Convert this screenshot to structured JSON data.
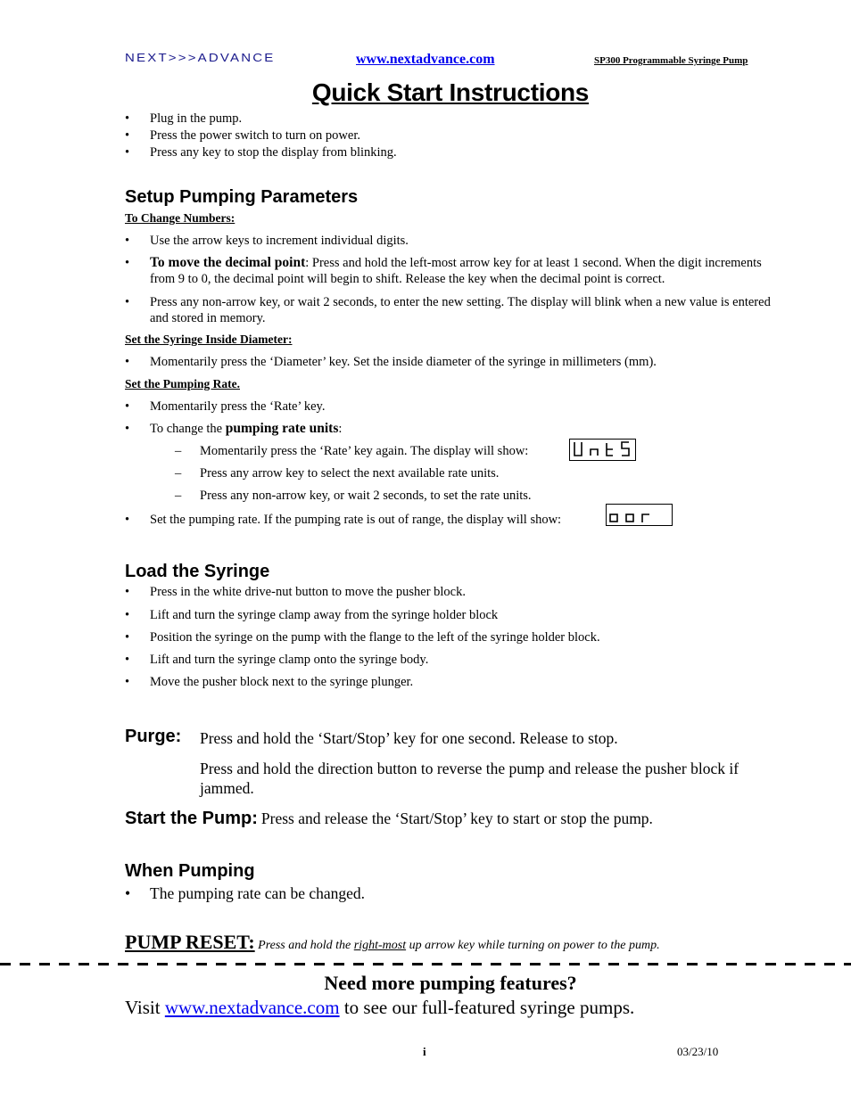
{
  "header": {
    "logo": "NEXT>>>ADVANCE",
    "website": "www.nextadvance.com",
    "product": "SP300 Programmable Syringe Pump"
  },
  "title": "Quick Start Instructions",
  "intro_bullets": [
    "Plug in the pump.",
    "Press the power switch to turn on power.",
    "Press any key to stop the display from blinking."
  ],
  "setup": {
    "heading": "Setup Pumping Parameters",
    "change_numbers": {
      "heading": "To Change Numbers:",
      "bullet1": "Use the arrow keys to increment individual digits.",
      "bullet2_bold": "To move the decimal point",
      "bullet2_text": ":  Press and hold the left-most arrow key for at least 1 second.  When the digit increments from 9 to 0, the decimal point will begin to shift.  Release the key when the decimal point is correct.",
      "bullet3": "Press any non-arrow key, or wait 2 seconds, to enter the new setting.  The display will blink when a new value is entered and stored in memory."
    },
    "diameter": {
      "heading": "Set the Syringe Inside Diameter:",
      "bullet1": "Momentarily press the ‘Diameter’ key.  Set the inside diameter of the syringe in millimeters (mm)."
    },
    "rate": {
      "heading": "Set the Pumping Rate.",
      "bullet1": "Momentarily press the ‘Rate’ key.",
      "bullet2_prefix": "To change the ",
      "bullet2_bold": "pumping rate units",
      "bullet2_suffix": ":",
      "sub1": "Momentarily press the ‘Rate’ key again.  The display will show:",
      "sub1_display": "UntS",
      "sub2": "Press any arrow key to select the next available rate units.",
      "sub3": "Press any non-arrow key, or wait 2 seconds, to set the rate units.",
      "bullet3": "Set the pumping rate.  If the pumping rate is out of range, the display will show:",
      "bullet3_display": "oor"
    }
  },
  "load": {
    "heading": "Load the Syringe",
    "bullets": [
      "Press in the white drive-nut button to move the pusher block.",
      "Lift and turn the syringe clamp away from the syringe holder block",
      "Position the syringe on the pump with the flange to the left of the syringe holder block.",
      "Lift and turn the syringe clamp onto the syringe body.",
      "Move the pusher block next to the syringe plunger."
    ]
  },
  "purge": {
    "label": "Purge:",
    "text1": "Press and hold the ‘Start/Stop’ key for one second.  Release to stop.",
    "text2": "Press and hold the direction button to reverse the pump and release the pusher block if jammed."
  },
  "start": {
    "label": "Start the Pump:",
    "text": "Press and release the ‘Start/Stop’ key to start or stop the pump."
  },
  "when_pumping": {
    "heading": "When Pumping",
    "bullet": "The pumping rate can be changed."
  },
  "reset": {
    "label": "PUMP RESET:",
    "text_pre": " Press and hold the ",
    "text_underlined": "right-most",
    "text_post": " up arrow key while turning on power to the pump."
  },
  "footer": {
    "heading": "Need more pumping features?",
    "visit_pre": "Visit ",
    "visit_link": "www.nextadvance.com",
    "visit_post": " to see our full-featured syringe pumps.",
    "page_number": "i",
    "date": "03/23/10"
  },
  "colors": {
    "logo": "#1a1a8c",
    "link": "#0000ee"
  }
}
